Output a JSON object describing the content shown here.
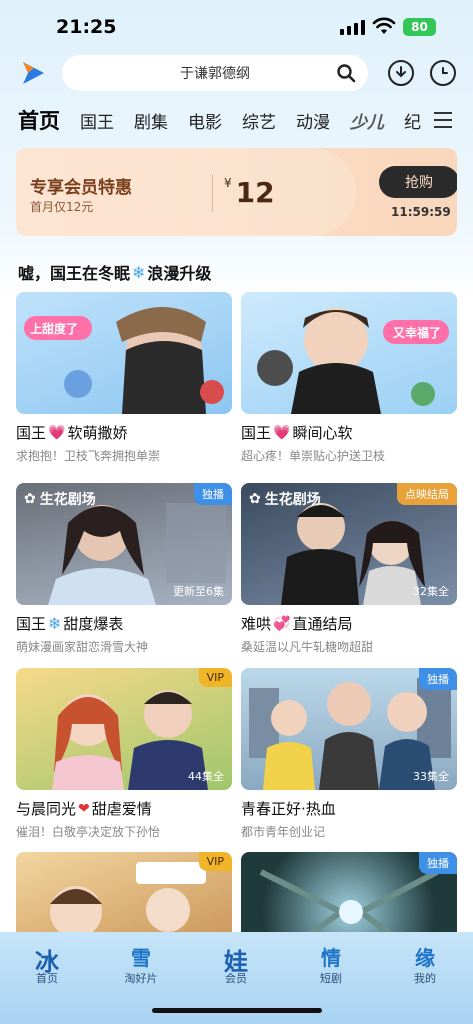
{
  "status": {
    "time": "21:25",
    "battery": "80"
  },
  "search": {
    "query": "于谦郭德纲"
  },
  "tabs": [
    "首页",
    "国王",
    "剧集",
    "电影",
    "综艺",
    "动漫",
    "少儿",
    "纪"
  ],
  "vip": {
    "title": "专享会员特惠",
    "subtitle": "首月仅12元",
    "currency": "¥",
    "price": "12",
    "buy_label": "抢购",
    "countdown": "11:59:59"
  },
  "section": {
    "title_a": "嘘，国王在冬眠",
    "title_b": "浪漫升级"
  },
  "cards": [
    {
      "title_a": "国王",
      "title_b": "软萌撒娇",
      "subtitle": "求抱抱！卫枝飞奔拥抱单崇",
      "badge_text": "上甜度了"
    },
    {
      "title_a": "国王",
      "title_b": "瞬间心软",
      "subtitle": "超心疼！单崇贴心护送卫枝",
      "badge_text": "又幸福了"
    },
    {
      "title_a": "国王",
      "title_b": "甜度爆表",
      "subtitle": "萌妹漫画家甜恋滑雪大神",
      "studio": "生花剧场",
      "label": "独播",
      "episodes": "更新至6集"
    },
    {
      "title": "难哄",
      "title_b": "直通结局",
      "subtitle": "桑延温以凡牛轧糖吻超甜",
      "studio": "生花剧场",
      "label": "点映结局",
      "episodes": "32集全"
    },
    {
      "title_a": "与晨同光",
      "title_b": "甜虐爱情",
      "subtitle": "催泪！白敬亭决定放下孙怡",
      "label": "VIP",
      "episodes": "44集全"
    },
    {
      "title": "青春正好·热血",
      "subtitle": "都市青年创业记",
      "label": "独播",
      "episodes": "33集全"
    },
    {
      "label": "VIP"
    },
    {
      "label": "独播"
    }
  ],
  "nav": [
    {
      "icon": "冰",
      "label": "首页"
    },
    {
      "icon": "雪",
      "label": "淘好片"
    },
    {
      "icon": "娃",
      "label": "会员"
    },
    {
      "icon": "情",
      "label": "短剧"
    },
    {
      "icon": "缘",
      "label": "我的"
    }
  ],
  "colors": {
    "accent": "#1e74c8",
    "vip_label": "#f0b429",
    "exclusive_label": "#3e8fe6",
    "finale_label": "#e8a23a"
  }
}
